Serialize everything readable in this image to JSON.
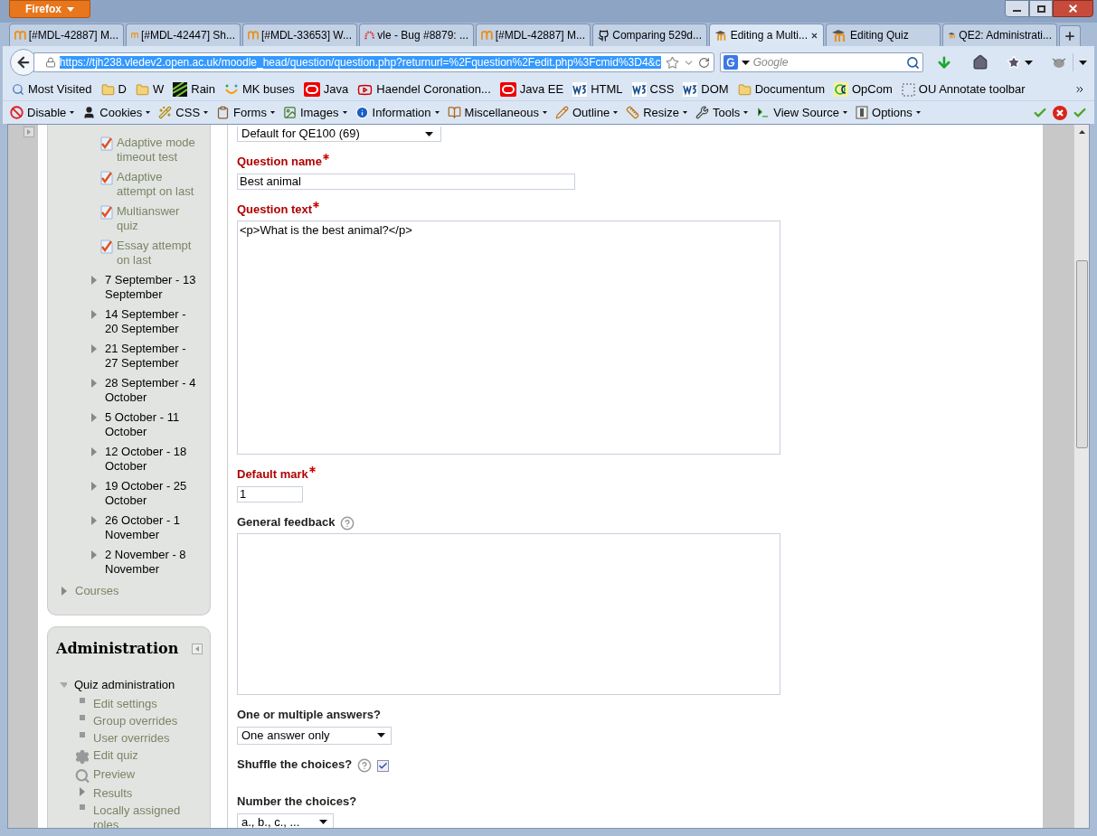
{
  "browser": {
    "app_button": "Firefox",
    "tabs": [
      {
        "label": "[#MDL-42887] M...",
        "kind": "moodle",
        "selected": false
      },
      {
        "label": "[#MDL-42447] Sh...",
        "kind": "moodle",
        "selected": false
      },
      {
        "label": "[#MDL-33653] W...",
        "kind": "moodle",
        "selected": false
      },
      {
        "label": "vle - Bug #8879: ...",
        "kind": "arc",
        "selected": false
      },
      {
        "label": "[#MDL-42887] M...",
        "kind": "moodle",
        "selected": false
      },
      {
        "label": "Comparing 529d...",
        "kind": "github",
        "selected": false
      },
      {
        "label": "Editing a Multi...",
        "kind": "moodlecap",
        "selected": true
      },
      {
        "label": "Editing Quiz",
        "kind": "moodlecap",
        "selected": false
      },
      {
        "label": "QE2: Administrati...",
        "kind": "moodlecap",
        "selected": false
      }
    ],
    "url": "https://tjh238.vledev2.open.ac.uk/moodle_head/question/question.php?returnurl=%2Fquestion%2Fedit.php%3Fcmid%3D4&c",
    "search": {
      "placeholder": "Google"
    },
    "bookmarks": [
      {
        "label": "Most Visited",
        "kind": "page"
      },
      {
        "label": "D",
        "kind": "folder"
      },
      {
        "label": "W",
        "kind": "folder"
      },
      {
        "label": "Rain",
        "kind": "rain"
      },
      {
        "label": "MK buses",
        "kind": "smile"
      },
      {
        "label": "Java",
        "kind": "oracle"
      },
      {
        "label": "Haendel Coronation...",
        "kind": "youtube"
      },
      {
        "label": "Java EE",
        "kind": "oracle"
      },
      {
        "label": "HTML",
        "kind": "w3"
      },
      {
        "label": "CSS",
        "kind": "w3"
      },
      {
        "label": "DOM",
        "kind": "w3"
      },
      {
        "label": "Documentum",
        "kind": "folder"
      },
      {
        "label": "OpCom",
        "kind": "oc"
      },
      {
        "label": "OU Annotate toolbar",
        "kind": "dashed"
      }
    ],
    "devtools": [
      {
        "label": "Disable",
        "kind": "disable"
      },
      {
        "label": "Cookies",
        "kind": "person"
      },
      {
        "label": "CSS",
        "kind": "wand"
      },
      {
        "label": "Forms",
        "kind": "clipboard"
      },
      {
        "label": "Images",
        "kind": "image"
      },
      {
        "label": "Information",
        "kind": "info"
      },
      {
        "label": "Miscellaneous",
        "kind": "book"
      },
      {
        "label": "Outline",
        "kind": "pencil"
      },
      {
        "label": "Resize",
        "kind": "ruler"
      },
      {
        "label": "Tools",
        "kind": "tools"
      },
      {
        "label": "View Source",
        "kind": "terminal"
      },
      {
        "label": "Options",
        "kind": "options"
      }
    ]
  },
  "sidebar": {
    "activities": [
      "Adaptive mode timeout test",
      "Adaptive attempt on last",
      "Multianswer quiz",
      "Essay attempt on last"
    ],
    "weeks": [
      "7 September - 13 September",
      "14 September - 20 September",
      "21 September - 27 September",
      "28 September - 4 October",
      "5 October - 11 October",
      "12 October - 18 October",
      "19 October - 25 October",
      "26 October - 1 November",
      "2 November - 8 November"
    ],
    "courses": "Courses",
    "administration": {
      "title": "Administration",
      "section": {
        "label": "Quiz administration",
        "expanded": true
      },
      "items": [
        {
          "label": "Edit settings",
          "kind": "bullet"
        },
        {
          "label": "Group overrides",
          "kind": "bullet"
        },
        {
          "label": "User overrides",
          "kind": "bullet"
        },
        {
          "label": "Edit quiz",
          "kind": "gear"
        },
        {
          "label": "Preview",
          "kind": "search"
        },
        {
          "label": "Results",
          "kind": "branch"
        },
        {
          "label": "Locally assigned roles",
          "kind": "bullet"
        }
      ]
    }
  },
  "form": {
    "category": "Default for QE100 (69)",
    "fields": [
      {
        "kind": "text",
        "label": "Question name",
        "required": true,
        "value": "Best animal"
      },
      {
        "kind": "editor",
        "label": "Question text",
        "required": true,
        "value": "<p>What is the best animal?</p>"
      },
      {
        "kind": "short",
        "label": "Default mark",
        "required": true,
        "value": "1"
      },
      {
        "kind": "area",
        "label": "General feedback",
        "required": false,
        "help": true
      },
      {
        "kind": "select",
        "label": "One or multiple answers?",
        "required": false,
        "value": "One answer only"
      },
      {
        "kind": "checkbox",
        "label": "Shuffle the choices?",
        "required": false,
        "help": true,
        "checked": true
      },
      {
        "kind": "smallselect",
        "label": "Number the choices?",
        "required": false,
        "value": "a., b., c., ..."
      }
    ]
  }
}
